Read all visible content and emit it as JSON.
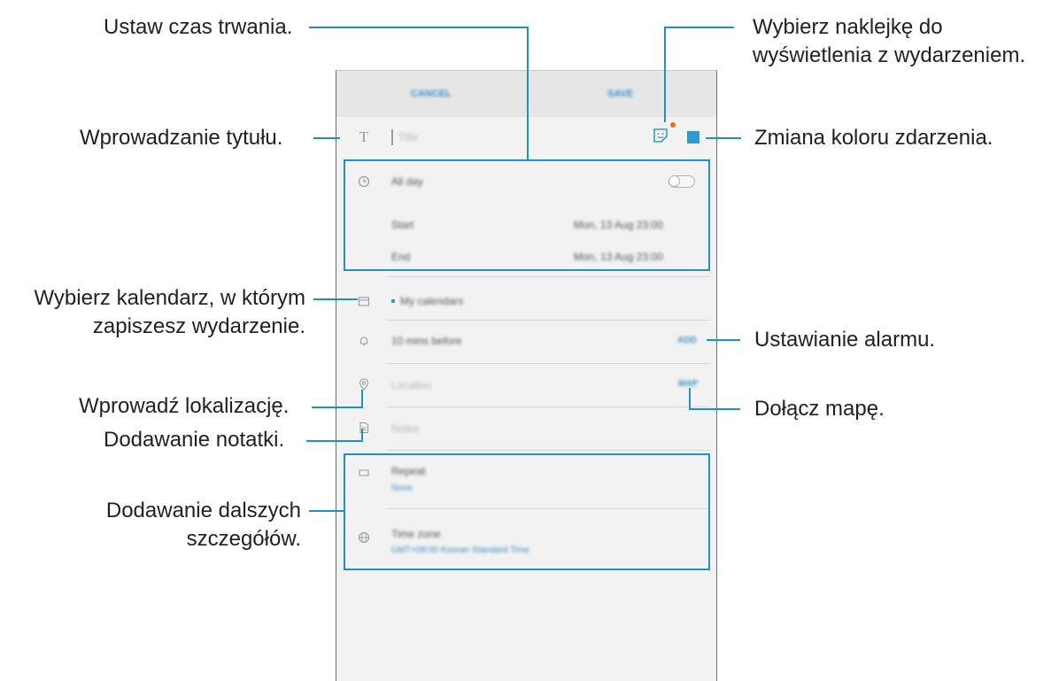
{
  "callouts": {
    "duration": "Ustaw czas trwania.",
    "title_input": "Wprowadzanie tytułu.",
    "calendar_line1": "Wybierz kalendarz, w którym",
    "calendar_line2": "zapiszesz wydarzenie.",
    "location": "Wprowadź lokalizację.",
    "note": "Dodawanie notatki.",
    "more_line1": "Dodawanie dalszych",
    "more_line2": "szczegółów.",
    "sticker_line1": "Wybierz naklejkę do",
    "sticker_line2": "wyświetlenia z wydarzeniem.",
    "color": "Zmiana koloru zdarzenia.",
    "alarm": "Ustawianie alarmu.",
    "map": "Dołącz mapę."
  },
  "screen": {
    "cancel": "CANCEL",
    "save": "SAVE",
    "title_placeholder": "Title",
    "all_day": "All day",
    "start_label": "Start",
    "start_value": "Mon, 13 Aug   23:00",
    "end_label": "End",
    "end_value": "Mon, 13 Aug   23:00",
    "calendar": "My calendars",
    "reminder": "10 mins before",
    "reminder_action": "ADD",
    "location_placeholder": "Location",
    "map_action": "MAP",
    "notes_placeholder": "Notes",
    "repeat_label": "Repeat",
    "repeat_value": "None",
    "timezone_label": "Time zone",
    "timezone_value": "GMT+09:00 Korean Standard Time"
  },
  "colors": {
    "accent": "#1c93c6",
    "event_color": "#2f9ccf",
    "badge": "#f26a21"
  },
  "icons": [
    "title-icon",
    "clock-icon",
    "calendar-icon",
    "bell-icon",
    "location-pin-icon",
    "note-icon",
    "repeat-icon",
    "globe-icon",
    "sticker-icon"
  ]
}
